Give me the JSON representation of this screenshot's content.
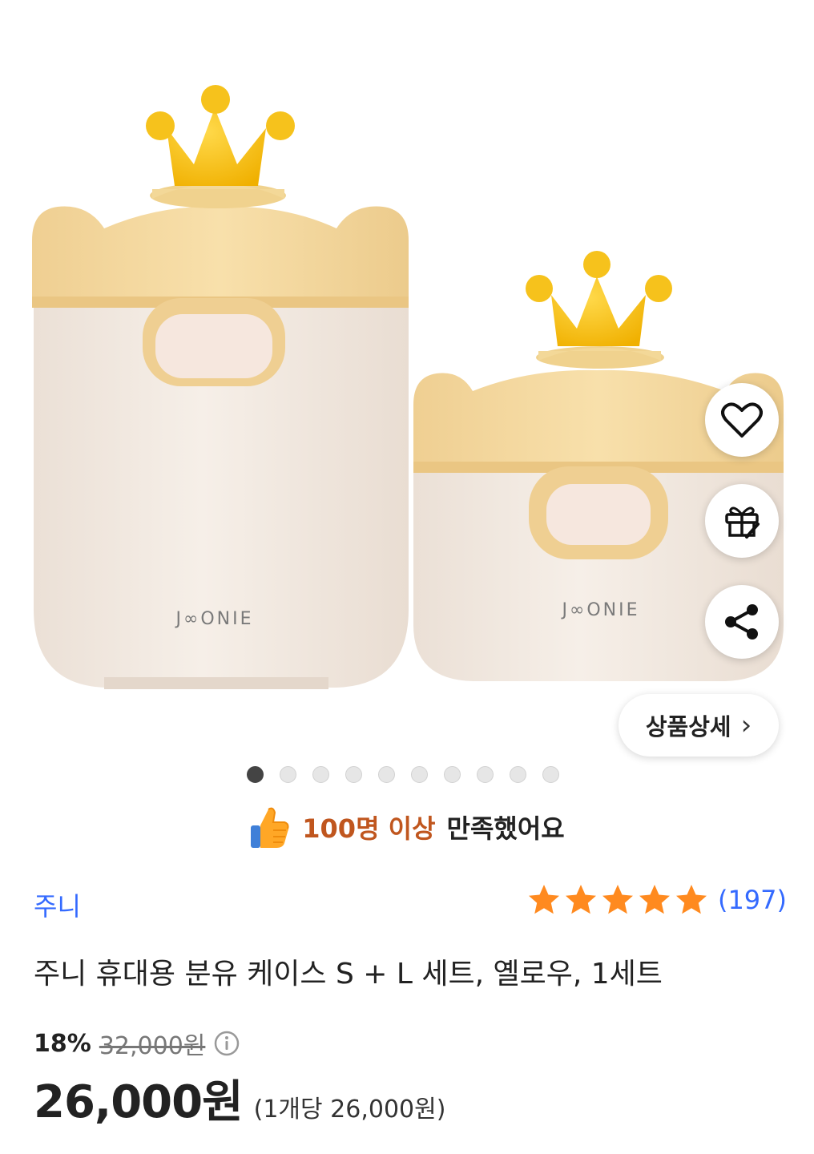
{
  "product_image": {
    "large_logo": "J∞ONIE",
    "small_logo": "J∞ONIE"
  },
  "actions": {
    "wishlist_icon": "heart-icon",
    "gift_icon": "gift-icon",
    "share_icon": "share-icon",
    "detail_label": "상품상세",
    "detail_chevron": "›"
  },
  "carousel": {
    "total_dots": 10,
    "active_index": 0
  },
  "satisfaction": {
    "icon": "thumbs-up-icon",
    "highlight": "100명 이상",
    "rest": "만족했어요"
  },
  "brand": "주니",
  "rating": {
    "stars": 5,
    "count": "(197)",
    "star_color": "#ff8a1f"
  },
  "title": "주니 휴대용 분유 케이스 S + L 세트, 옐로우, 1세트",
  "pricing": {
    "discount_rate": "18%",
    "original_price": "32,000원",
    "price": "26,000원",
    "unit_price": "(1개당 26,000원)"
  },
  "colors": {
    "link_blue": "#346aff",
    "highlight_orange": "#c0561e",
    "crown_yellow": "#f6c21c",
    "lid_yellow": "#f6d99a",
    "body_cream": "#f3e9df"
  }
}
